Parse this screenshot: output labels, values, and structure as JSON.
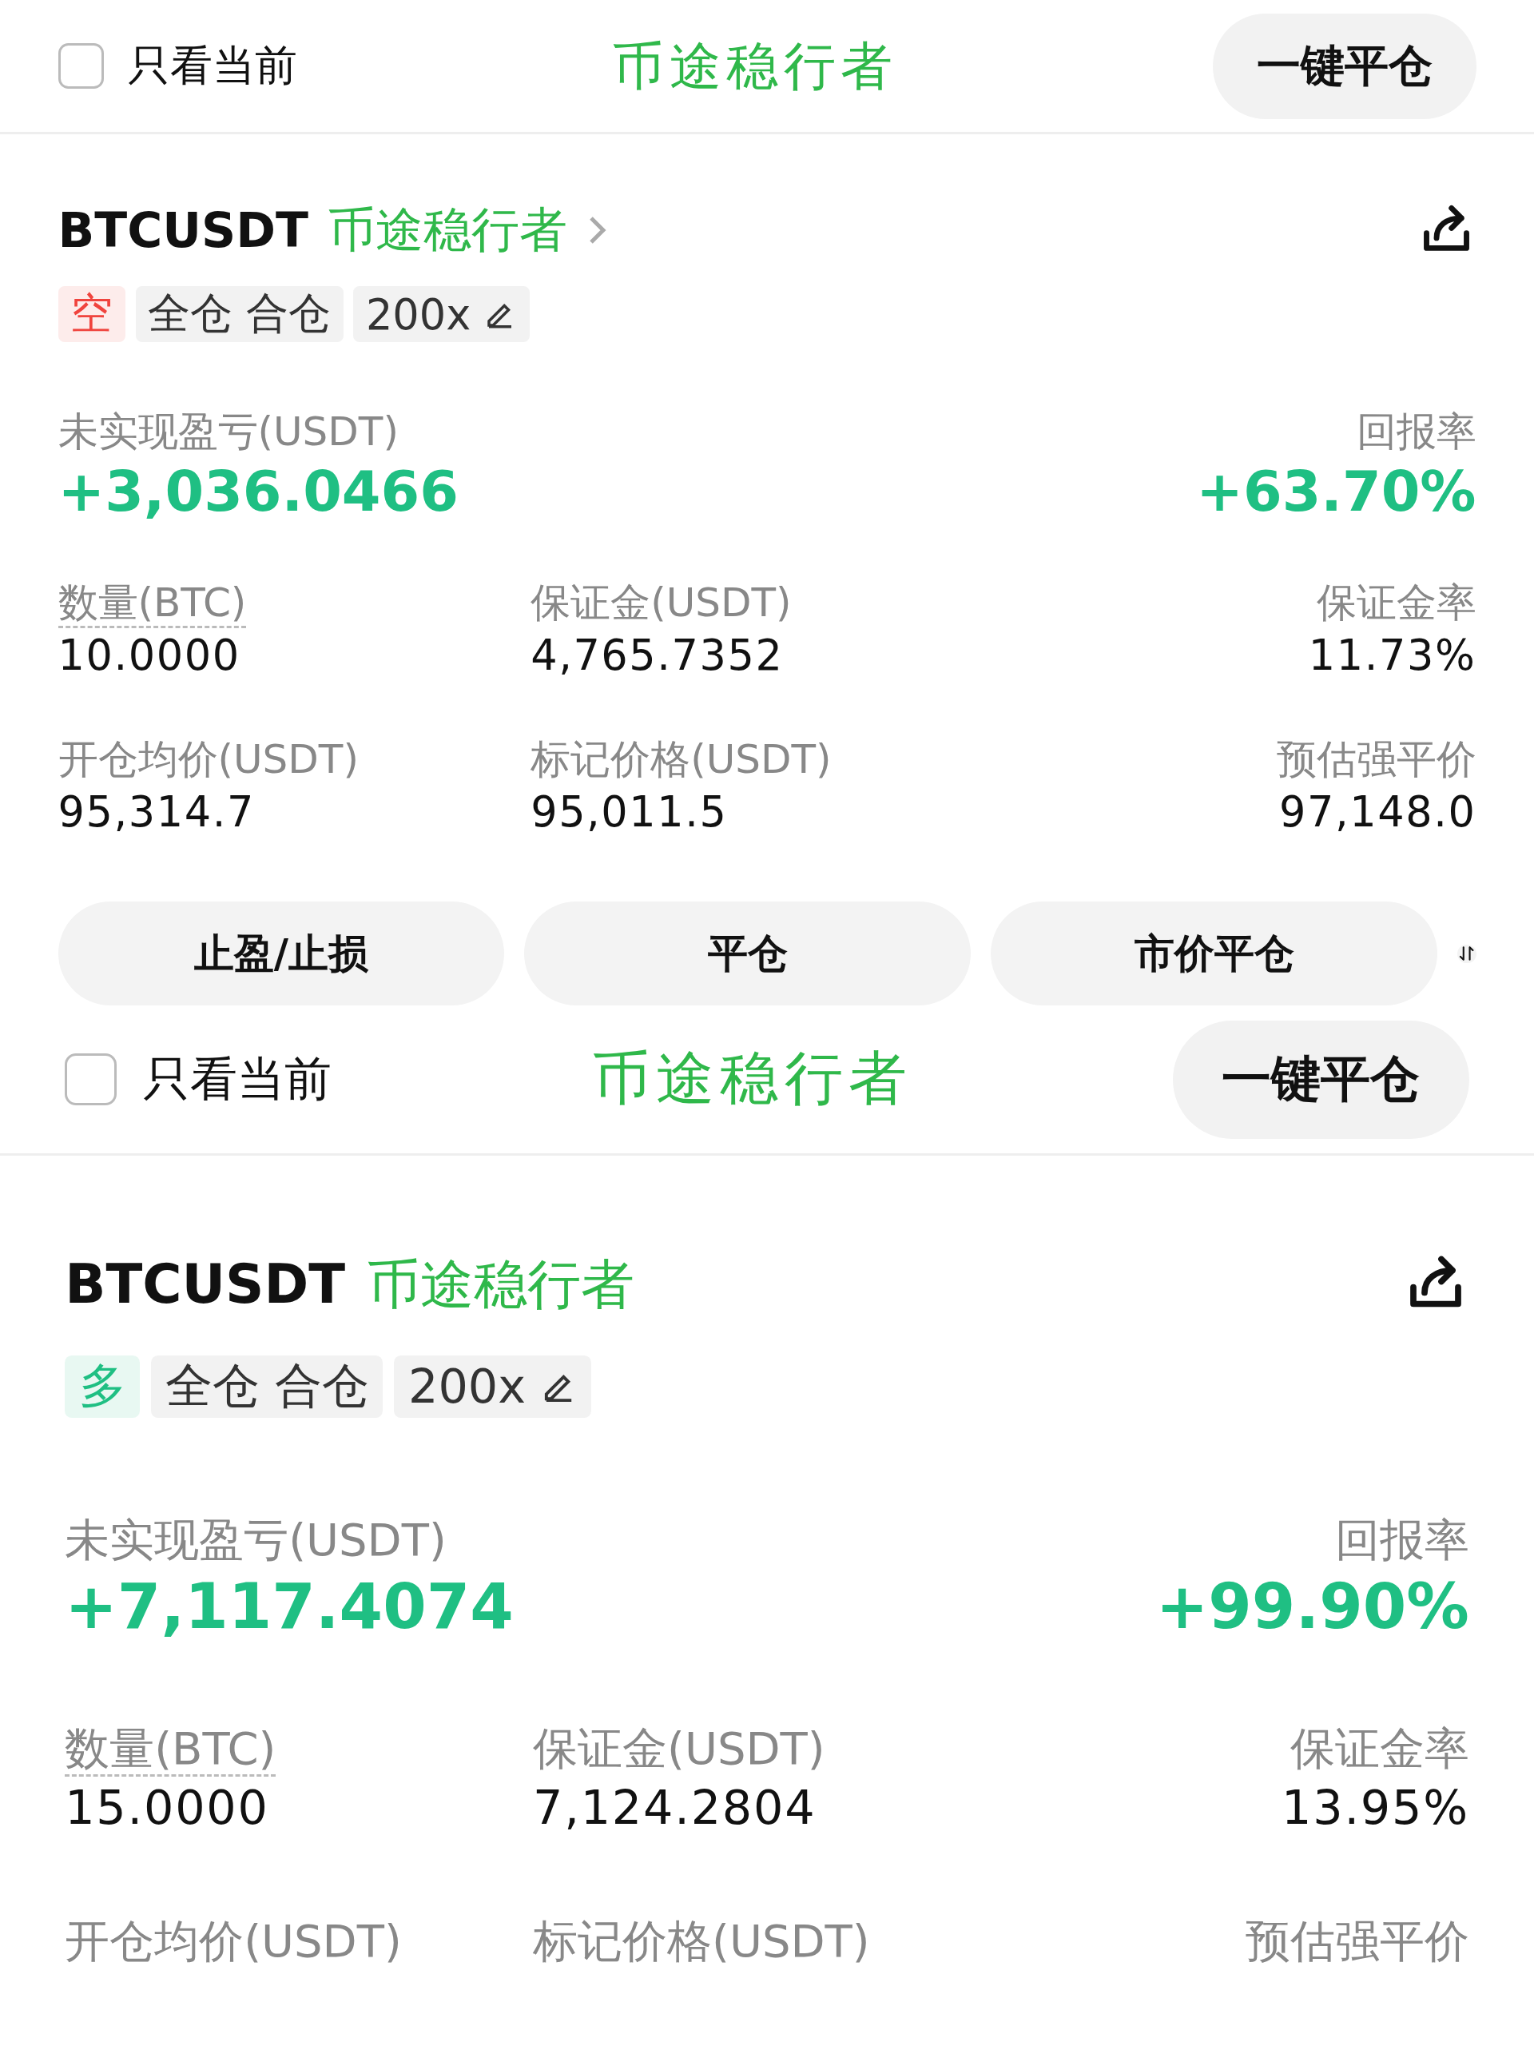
{
  "panels": [
    {
      "filter": {
        "label": "只看当前",
        "checked": false
      },
      "close_all_button": "一键平仓",
      "header_overlay": "币途稳行者",
      "symbol": "BTCUSDT",
      "symbol_overlay": "币途稳行者",
      "chevron": true,
      "tags": [
        {
          "kind": "side",
          "label": "空",
          "color": "#f0443e"
        },
        {
          "kind": "plain",
          "label": "全仓 合仓"
        },
        {
          "kind": "leverage",
          "label": "200x"
        }
      ],
      "pnl": {
        "label": "未实现盈亏(USDT)",
        "value": "+3,036.0466"
      },
      "roe": {
        "label": "回报率",
        "value": "+63.70%"
      },
      "fields": [
        {
          "label": "数量(BTC)",
          "value": "10.0000",
          "underlined": true
        },
        {
          "label": "保证金(USDT)",
          "value": "4,765.7352",
          "underlined": false
        },
        {
          "label": "保证金率",
          "value": "11.73%",
          "underlined": false
        },
        {
          "label": "开仓均价(USDT)",
          "value": "95,314.7",
          "underlined": false
        },
        {
          "label": "标记价格(USDT)",
          "value": "95,011.5",
          "underlined": false
        },
        {
          "label": "预估强平价",
          "value": "97,148.0",
          "underlined": false
        }
      ],
      "actions": [
        "止盈/止损",
        "平仓",
        "市价平仓"
      ]
    },
    {
      "filter": {
        "label": "只看当前",
        "checked": false
      },
      "close_all_button": "一键平仓",
      "header_overlay": "币途稳行者",
      "symbol": "BTCUSDT",
      "symbol_overlay": "币途稳行者",
      "chevron": false,
      "tags": [
        {
          "kind": "side",
          "label": "多",
          "color": "#1fbf83"
        },
        {
          "kind": "plain",
          "label": "全仓 合仓"
        },
        {
          "kind": "leverage",
          "label": "200x"
        }
      ],
      "pnl": {
        "label": "未实现盈亏(USDT)",
        "value": "+7,117.4074"
      },
      "roe": {
        "label": "回报率",
        "value": "+99.90%"
      },
      "fields": [
        {
          "label": "数量(BTC)",
          "value": "15.0000",
          "underlined": true
        },
        {
          "label": "保证金(USDT)",
          "value": "7,124.2804",
          "underlined": false
        },
        {
          "label": "保证金率",
          "value": "13.95%",
          "underlined": false
        },
        {
          "label": "开仓均价(USDT)",
          "underlined": false
        },
        {
          "label": "标记价格(USDT)",
          "underlined": false
        },
        {
          "label": "预估强平价",
          "underlined": false
        }
      ]
    }
  ]
}
